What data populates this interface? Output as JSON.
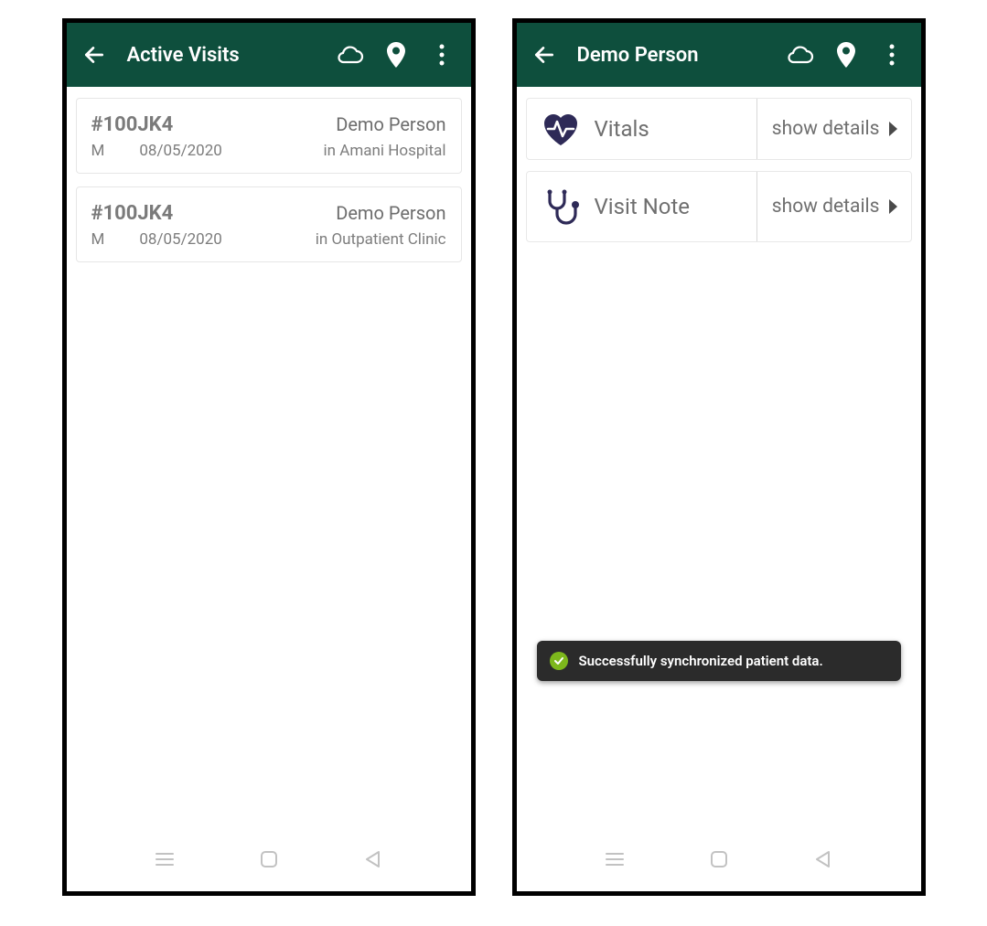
{
  "left": {
    "title": "Active Visits",
    "visits": [
      {
        "pid": "#100JK4",
        "name": "Demo Person",
        "gender": "M",
        "date": "08/05/2020",
        "loc": "in Amani Hospital"
      },
      {
        "pid": "#100JK4",
        "name": "Demo Person",
        "gender": "M",
        "date": "08/05/2020",
        "loc": "in Outpatient Clinic"
      }
    ]
  },
  "right": {
    "title": "Demo Person",
    "sections": [
      {
        "icon": "vitals",
        "label": "Vitals",
        "action": "show details"
      },
      {
        "icon": "stetho",
        "label": "Visit Note",
        "action": "show details"
      }
    ],
    "toast": "Successfully synchronized patient data."
  }
}
